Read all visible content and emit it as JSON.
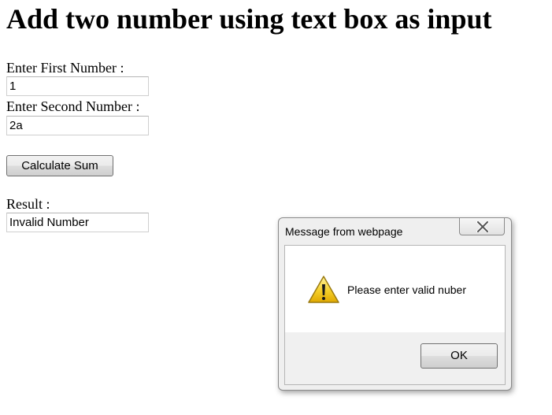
{
  "page": {
    "title": "Add two number using text box as input"
  },
  "form": {
    "first_label": "Enter First Number :",
    "first_value": "1",
    "second_label": "Enter Second Number :",
    "second_value": "2a",
    "calculate_label": "Calculate Sum",
    "result_label": "Result :",
    "result_value": "Invalid Number"
  },
  "dialog": {
    "title": "Message from webpage",
    "message": "Please enter valid nuber",
    "ok_label": "OK",
    "icon": "warning-icon",
    "close_icon": "close-icon"
  }
}
